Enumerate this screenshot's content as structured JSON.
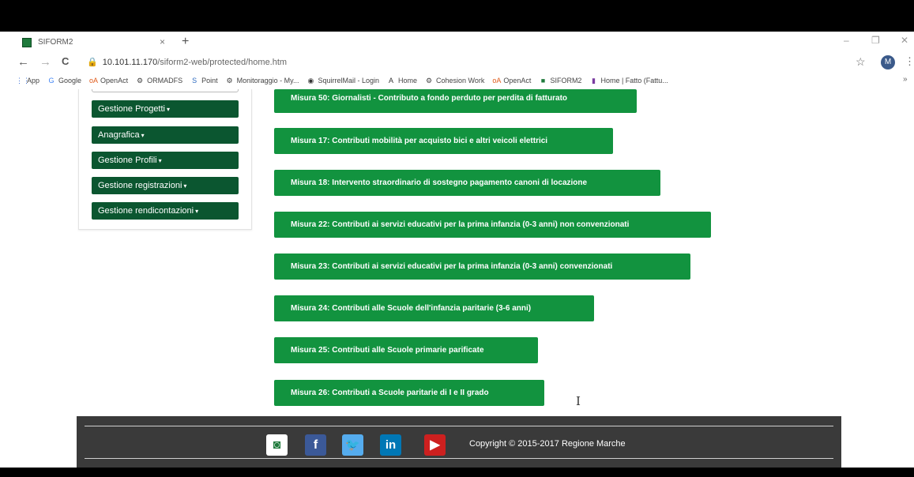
{
  "browser": {
    "tab_title": "SIFORM2",
    "tab_close": "×",
    "new_tab": "+",
    "minimize": "–",
    "restore": "❐",
    "close": "✕",
    "back": "←",
    "forward": "→",
    "reload": "C",
    "url_host": "10.101.11.170",
    "url_path": "/siform2-web/protected/home.htm",
    "star": "☆",
    "profile_initial": "M",
    "menu": "⋮",
    "bookmarks": [
      {
        "label": "App",
        "icon": "apps-grid-icon",
        "glyph": "⋮⋮",
        "color": "#3a6fd8"
      },
      {
        "label": "Google",
        "icon": "google-icon",
        "glyph": "G",
        "color": "#4285f4"
      },
      {
        "label": "OpenAct",
        "icon": "openact-icon",
        "glyph": "oA",
        "color": "#e05a1a"
      },
      {
        "label": "ORMADFS",
        "icon": "globe-icon",
        "glyph": "⚙",
        "color": "#444"
      },
      {
        "label": "Point",
        "icon": "sharepoint-icon",
        "glyph": "S",
        "color": "#2f6cc0"
      },
      {
        "label": "Monitoraggio - My...",
        "icon": "globe-icon",
        "glyph": "⚙",
        "color": "#444"
      },
      {
        "label": "SquirrelMail - Login",
        "icon": "squirrelmail-icon",
        "glyph": "◉",
        "color": "#333"
      },
      {
        "label": "Home",
        "icon": "a-letter-icon",
        "glyph": "A",
        "color": "#333"
      },
      {
        "label": "Cohesion Work",
        "icon": "globe-icon",
        "glyph": "⚙",
        "color": "#444"
      },
      {
        "label": "OpenAct",
        "icon": "openact-icon",
        "glyph": "oA",
        "color": "#e05a1a"
      },
      {
        "label": "SIFORM2",
        "icon": "siform-icon",
        "glyph": "■",
        "color": "#1f7a3c"
      },
      {
        "label": "Home | Fatto (Fattu...",
        "icon": "fatto-icon",
        "glyph": "▮",
        "color": "#7a3ca0"
      }
    ],
    "bookmarks_more": "»"
  },
  "sidebar": {
    "items": [
      {
        "label": "Gestione Progetti"
      },
      {
        "label": "Anagrafica"
      },
      {
        "label": "Gestione Profili"
      },
      {
        "label": "Gestione registrazioni"
      },
      {
        "label": "Gestione rendicontazioni"
      }
    ],
    "caret": "▾"
  },
  "misure": [
    {
      "label": "Misura 50: Giornalisti - Contributo a fondo perduto per perdita di fatturato"
    },
    {
      "label": "Misura 17: Contributi mobilità per acquisto bici e altri veicoli elettrici"
    },
    {
      "label": "Misura 18: Intervento straordinario di sostegno pagamento canoni di locazione"
    },
    {
      "label": "Misura 22: Contributi ai servizi educativi per la prima infanzia (0-3 anni) non convenzionati"
    },
    {
      "label": "Misura 23: Contributi ai servizi educativi per la prima infanzia (0-3 anni) convenzionati"
    },
    {
      "label": "Misura 24: Contributi alle Scuole dell'infanzia paritarie (3-6 anni)"
    },
    {
      "label": "Misura 25: Contributi alle Scuole primarie parificate"
    },
    {
      "label": "Misura 26: Contributi a Scuole paritarie di I e II grado"
    }
  ],
  "cursor_glyph": "I",
  "footer": {
    "social": [
      {
        "name": "regione-marche-logo-icon",
        "glyph": "◙",
        "bg": "#ffffff",
        "fg": "#1f7a3c"
      },
      {
        "name": "facebook-icon",
        "glyph": "f",
        "bg": "#3b5998",
        "fg": "#ffffff"
      },
      {
        "name": "twitter-icon",
        "glyph": "🐦",
        "bg": "#55acee",
        "fg": "#ffffff"
      },
      {
        "name": "linkedin-icon",
        "glyph": "in",
        "bg": "#0077b5",
        "fg": "#ffffff"
      },
      {
        "name": "youtube-icon",
        "glyph": "▶",
        "bg": "#cd201f",
        "fg": "#ffffff"
      }
    ],
    "copyright": "Copyright © 2015-2017 Regione Marche"
  },
  "colors": {
    "menu_button": "#0b5630",
    "misura_button": "#12933f",
    "footer_bg": "#3a3a3a"
  }
}
